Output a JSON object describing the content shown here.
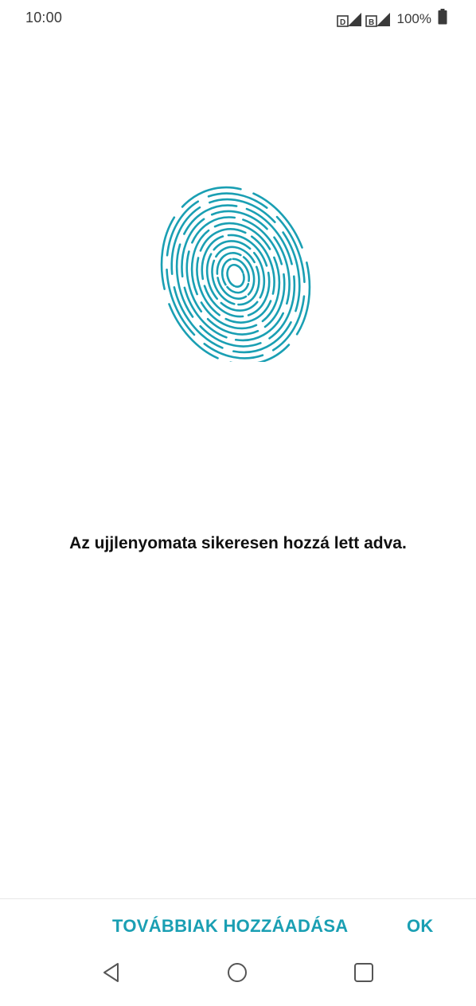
{
  "status_bar": {
    "time": "10:00",
    "battery_percent": "100%",
    "sim_badges": [
      "D",
      "B"
    ],
    "battery_level": 1.0,
    "icons": [
      "sim-1-signal-icon",
      "sim-2-signal-icon",
      "battery-icon"
    ]
  },
  "main": {
    "icon": "fingerprint-icon",
    "message": "Az ujjlenyomata sikeresen hozzá lett adva."
  },
  "actions": {
    "add_more_label": "TOVÁBBIAK HOZZÁADÁSA",
    "ok_label": "OK"
  },
  "nav_bar": {
    "icons": [
      "back-icon",
      "home-icon",
      "recents-icon"
    ]
  },
  "colors": {
    "accent": "#1a9fb3",
    "text": "#111111",
    "status_text": "#3a3a3a"
  }
}
